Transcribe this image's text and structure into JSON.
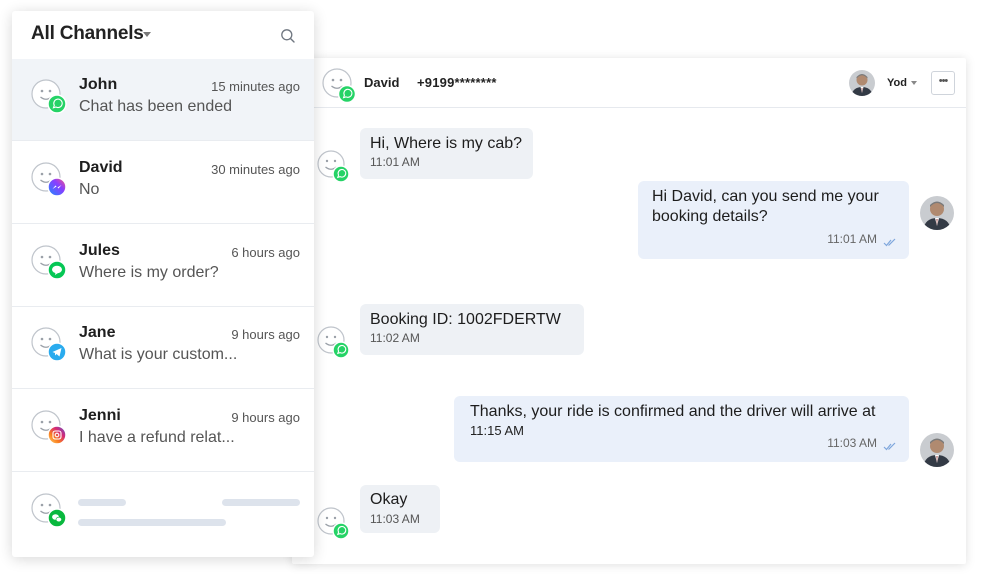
{
  "list": {
    "title": "All Channels",
    "conversations": [
      {
        "name": "John",
        "time": "15 minutes ago",
        "preview": "Chat has been ended",
        "channel": "whatsapp-icon",
        "channel_color": "#25D366"
      },
      {
        "name": "David",
        "time": "30 minutes ago",
        "preview": "No",
        "channel": "messenger-icon",
        "channel_color": "#7b4dff"
      },
      {
        "name": "Jules",
        "time": "6 hours ago",
        "preview": "Where is my order?",
        "channel": "line-icon",
        "channel_color": "#06C755"
      },
      {
        "name": "Jane",
        "time": "9 hours ago",
        "preview": "What is your custom...",
        "channel": "telegram-icon",
        "channel_color": "#2AABEE"
      },
      {
        "name": "Jenni",
        "time": "9 hours ago",
        "preview": "I have a refund relat...",
        "channel": "instagram-icon",
        "channel_color": "#dd2a7b"
      }
    ],
    "placeholder_channel": "wechat-icon"
  },
  "chat": {
    "contact_name": "David",
    "contact_phone": "+9199********",
    "agent_name": "Yod",
    "messages": [
      {
        "direction": "in",
        "text": "Hi, Where is my cab?",
        "time": "11:01 AM"
      },
      {
        "direction": "out",
        "text_line1": "Hi David, can you send me your",
        "text_line2": "booking details?",
        "time": "11:01 AM"
      },
      {
        "direction": "in",
        "text": "Booking ID: 1002FDERTW",
        "time": "11:02 AM"
      },
      {
        "direction": "out",
        "text_line1": "Thanks, your ride is confirmed and the driver will arrive at",
        "text_line2": "11:15 AM",
        "time": "11:03 AM"
      },
      {
        "direction": "in",
        "text": "Okay",
        "time": "11:03 AM"
      }
    ]
  },
  "colors": {
    "whatsapp": "#25D366",
    "read_ticks": "#7ea6dc",
    "incoming_bubble": "#eef1f5",
    "outgoing_bubble": "#eaf0fa"
  }
}
